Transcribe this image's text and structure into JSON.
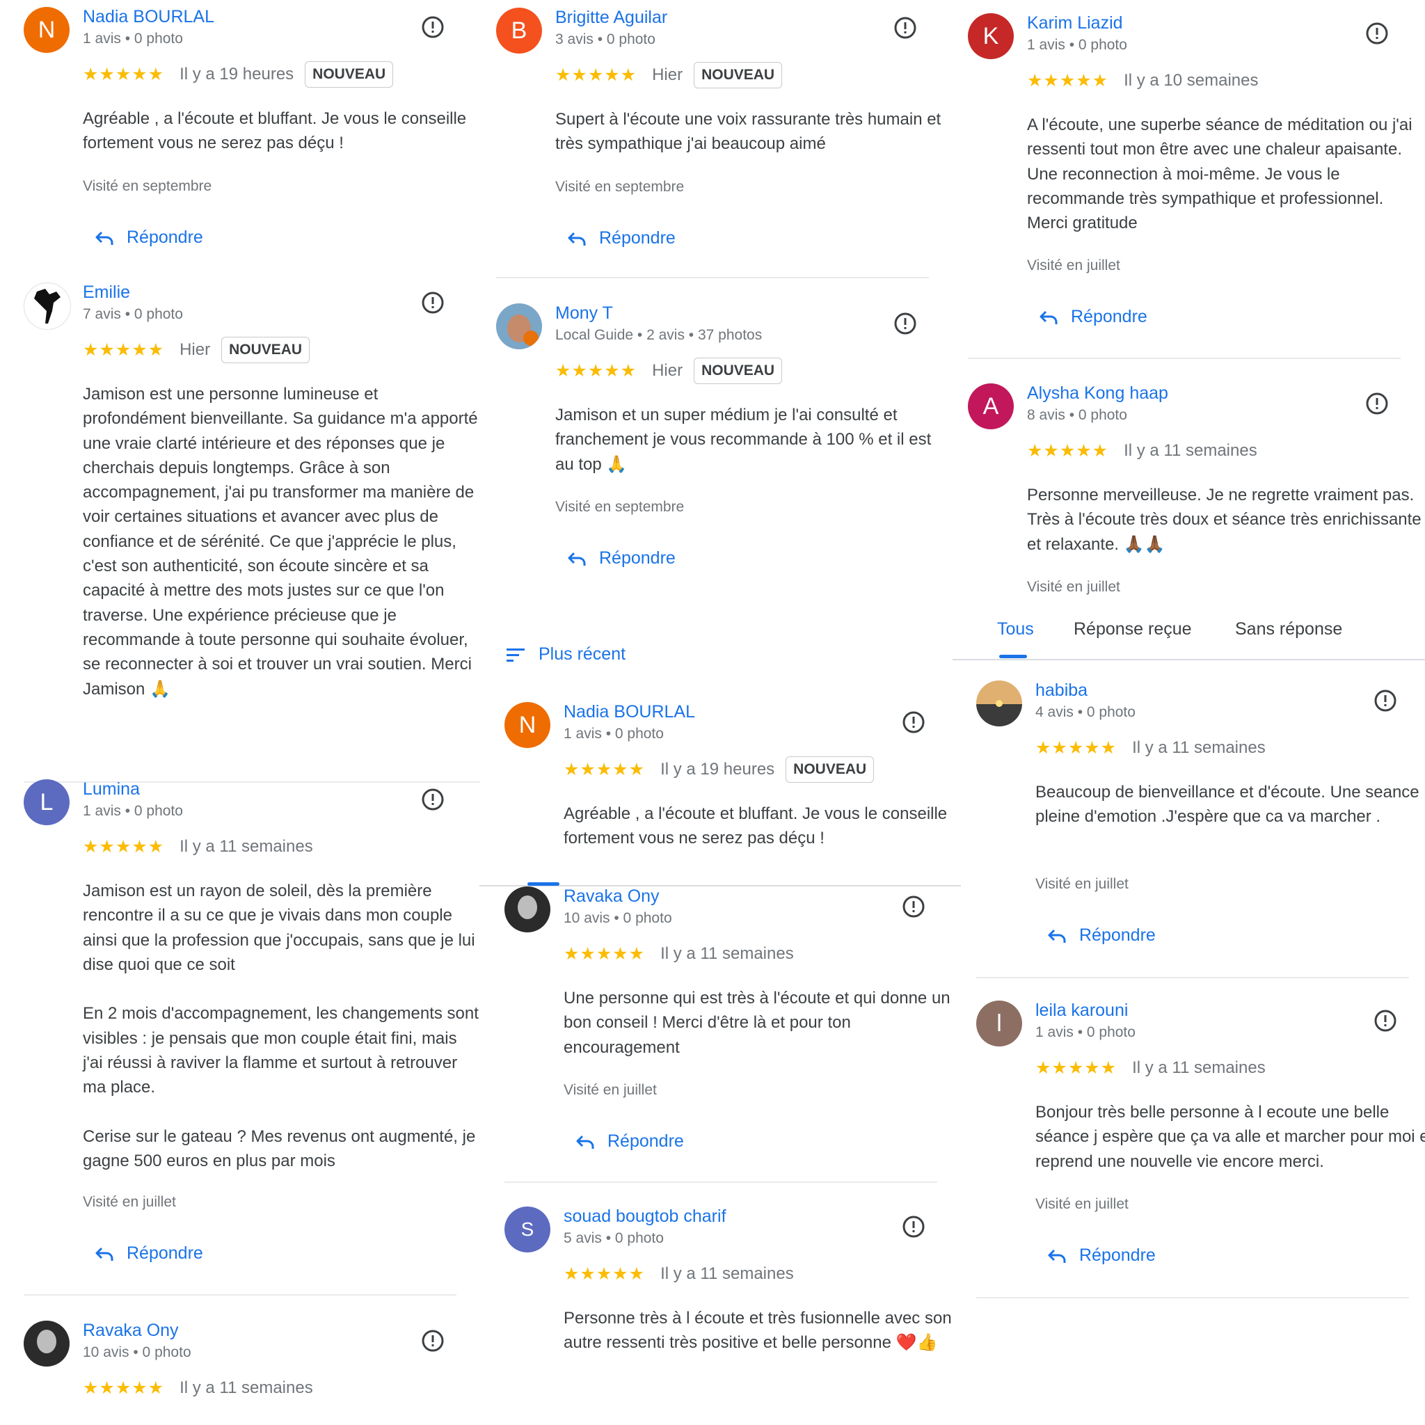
{
  "colors": {
    "link": "#1a73e8",
    "star": "#fbbc04",
    "text": "#3c4043",
    "muted": "#70757a"
  },
  "icons": {
    "report": "report-flag-icon",
    "reply": "reply-arrow-icon",
    "sort": "sort-lines-icon"
  },
  "reply_label": "Répondre",
  "new_badge": "NOUVEAU",
  "stars": "★★★★★",
  "sort_label": "Plus récent",
  "tabs": [
    "Tous",
    "Réponse reçue",
    "Sans réponse"
  ],
  "reviews": [
    {
      "initial": "N",
      "avatar_color": "#ef6c00",
      "name": "Nadia BOURLAL",
      "meta": "1 avis • 0 photo",
      "time": "Il y a 19 heures",
      "badge": "NOUVEAU",
      "text": "Agréable , a l'écoute et bluffant. Je vous le conseille fortement vous ne serez pas déçu !",
      "visited": "Visité en septembre"
    },
    {
      "initial": "",
      "avatar_color": "",
      "name": "Emilie",
      "meta": "7 avis • 0 photo",
      "time": "Hier",
      "badge": "NOUVEAU",
      "text": "Jamison est une personne lumineuse et profondément bienveillante. Sa guidance m'a apporté une vraie clarté intérieure et des réponses que je cherchais depuis longtemps. Grâce à son accompagnement, j'ai pu transformer ma manière de voir certaines situations et avancer avec plus de confiance et de sérénité. Ce que j'apprécie le plus, c'est son authenticité, son écoute sincère et sa capacité à mettre des mots justes sur ce que l'on traverse. Une expérience précieuse que je recommande à toute personne qui souhaite évoluer, se reconnecter à soi et trouver un vrai soutien. Merci Jamison 🙏",
      "visited": ""
    },
    {
      "initial": "L",
      "avatar_color": "#5c6bc0",
      "name": "Lumina",
      "meta": "1 avis • 0 photo",
      "time": "Il y a 11 semaines",
      "badge": "",
      "text": "Jamison est un rayon de soleil, dès la première rencontre il a su ce que je vivais dans mon couple ainsi que la profession que j'occupais, sans que je lui dise quoi que ce soit\n\nEn 2 mois d'accompagnement, les changements sont visibles : je pensais que mon couple était fini, mais j'ai réussi à raviver la flamme et surtout à retrouver ma place.\n\nCerise sur le gateau ? Mes revenus ont augmenté, je gagne 500 euros en plus par mois",
      "visited": "Visité en juillet"
    },
    {
      "initial": "",
      "avatar_color": "",
      "name": "Ravaka Ony",
      "meta": "10 avis • 0 photo",
      "time": "Il y a 11 semaines",
      "badge": "",
      "text": "",
      "visited": ""
    },
    {
      "initial": "B",
      "avatar_color": "#f4511e",
      "name": "Brigitte Aguilar",
      "meta": "3 avis • 0 photo",
      "time": "Hier",
      "badge": "NOUVEAU",
      "text": "Supert à l'écoute une voix rassurante très humain et très sympathique j'ai beaucoup aimé",
      "visited": "Visité en septembre"
    },
    {
      "initial": "",
      "avatar_color": "",
      "name": "Mony T",
      "meta": "Local Guide • 2 avis • 37 photos",
      "time": "Hier",
      "badge": "NOUVEAU",
      "text": "Jamison et un super médium je l'ai consulté et franchement je vous recommande à 100 % et il est au top 🙏",
      "visited": "Visité en septembre"
    },
    {
      "initial": "N",
      "avatar_color": "#ef6c00",
      "name": "Nadia BOURLAL",
      "meta": "1 avis • 0 photo",
      "time": "Il y a 19 heures",
      "badge": "NOUVEAU",
      "text": "Agréable , a l'écoute et bluffant. Je vous le conseille fortement vous ne serez pas déçu !",
      "visited": ""
    },
    {
      "initial": "",
      "avatar_color": "",
      "name": "Ravaka Ony",
      "meta": "10 avis • 0 photo",
      "time": "Il y a 11 semaines",
      "badge": "",
      "text": "Une personne qui est très à l'écoute et qui donne un bon conseil ! Merci d'être là et pour ton encouragement",
      "visited": "Visité en juillet"
    },
    {
      "initial": "S",
      "avatar_color": "#5c6bc0",
      "name": "souad bougtob charif",
      "meta": "5 avis • 0 photo",
      "time": "Il y a 11 semaines",
      "badge": "",
      "text": "Personne très à l écoute et très fusionnelle avec son autre ressenti très positive et belle personne ❤️👍",
      "visited": ""
    },
    {
      "initial": "K",
      "avatar_color": "#c62828",
      "name": "Karim Liazid",
      "meta": "1 avis • 0 photo",
      "time": "Il y a 10 semaines",
      "badge": "",
      "text": "A l'écoute, une superbe séance de méditation ou j'ai ressenti tout mon être avec une chaleur apaisante. Une reconnection à moi-même. Je vous le recommande très sympathique et professionnel. Merci gratitude",
      "visited": "Visité en juillet"
    },
    {
      "initial": "A",
      "avatar_color": "#c2185b",
      "name": "Alysha Kong haap",
      "meta": "8 avis • 0 photo",
      "time": "Il y a 11 semaines",
      "badge": "",
      "text": "Personne merveilleuse. Je ne regrette vraiment pas. Très à l'écoute très doux et séance très enrichissante et relaxante. 🙏🏾🙏🏾",
      "visited": "Visité en juillet"
    },
    {
      "initial": "",
      "avatar_color": "",
      "name": "habiba",
      "meta": "4 avis • 0 photo",
      "time": "Il y a 11 semaines",
      "badge": "",
      "text": "Beaucoup de bienveillance et d'écoute. Une seance pleine d'emotion .J'espère que ca va marcher .",
      "visited": "Visité en juillet"
    },
    {
      "initial": "l",
      "avatar_color": "#8d6e63",
      "name": "leila karouni",
      "meta": "1 avis • 0 photo",
      "time": "Il y a 11 semaines",
      "badge": "",
      "text": "Bonjour très belle personne à l ecoute une belle séance j espère que ça va alle et marcher pour moi et reprend une nouvelle vie encore merci.",
      "visited": "Visité en juillet"
    }
  ]
}
